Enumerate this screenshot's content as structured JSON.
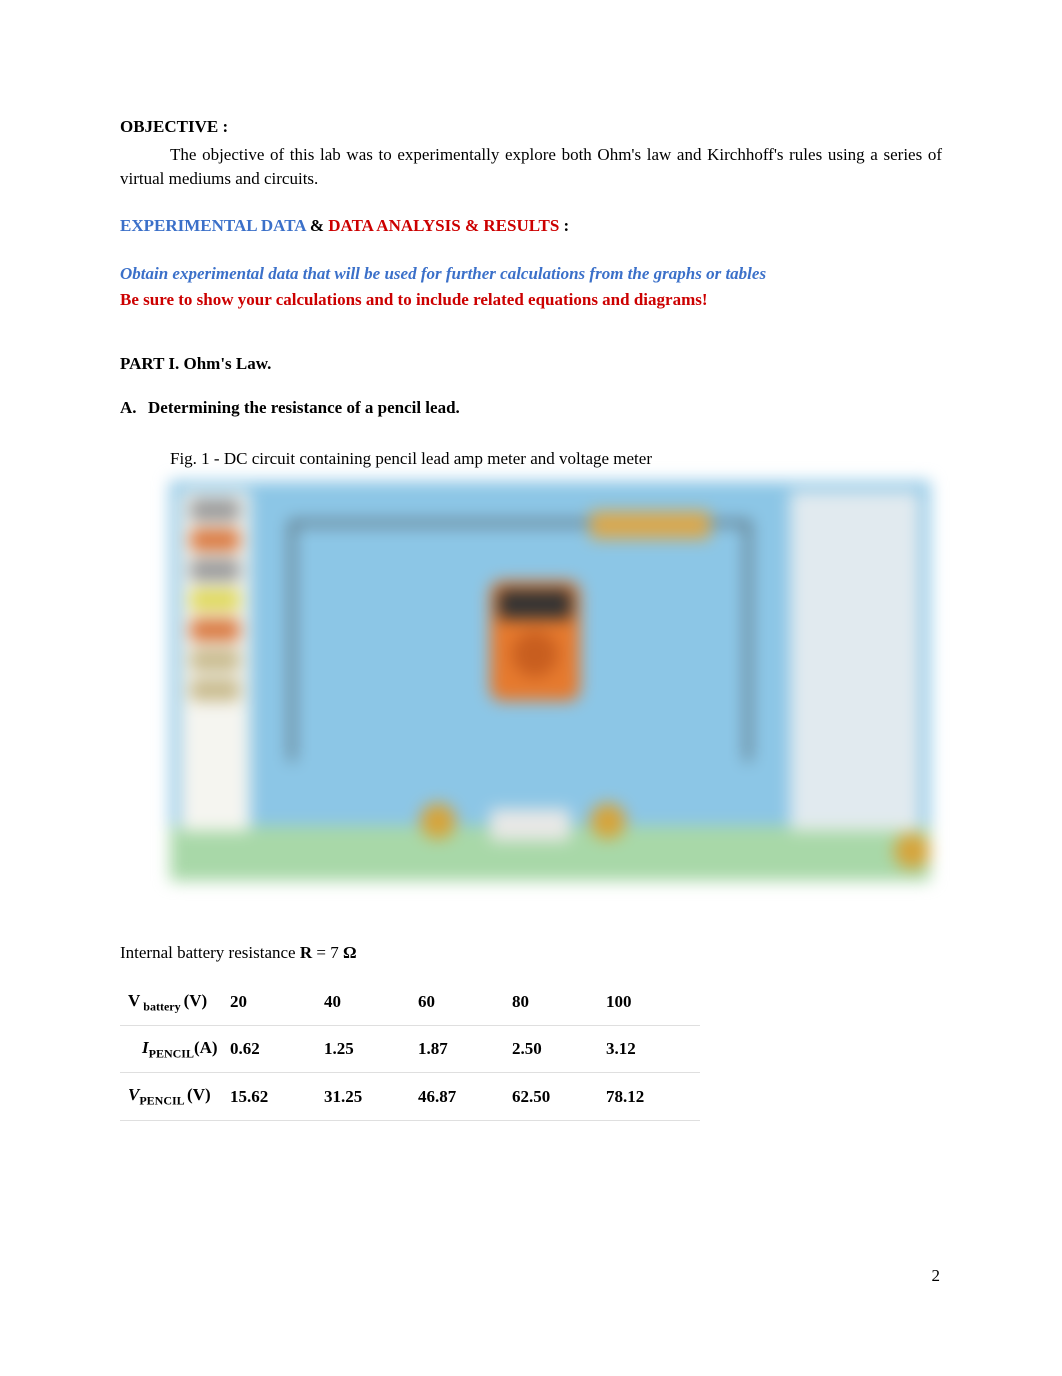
{
  "objective": {
    "title": "OBJECTIVE :",
    "text": "The objective of this lab was to experimentally explore both Ohm's law and Kirchhoff's rules using a series of virtual mediums and circuits."
  },
  "expHeader": {
    "blue": "EXPERIMENTAL DATA",
    "amp": "  &  ",
    "red": "DATA ANALYSIS & RESULTS",
    "colon": " :"
  },
  "instructions": {
    "italic": "Obtain experimental data that will be used for further calculations from the graphs or tables",
    "bold": "Be sure to show your calculations and to include related equations and diagrams!"
  },
  "part1": {
    "title": "PART I. Ohm's Law.",
    "subsection": {
      "letter": "A.",
      "text": "Determining the resistance of a pencil lead."
    },
    "figCaption": "Fig. 1 - DC circuit containing pencil lead amp meter and voltage meter"
  },
  "resistance": {
    "prefix": "Internal battery resistance ",
    "symbol": "R",
    "equals": " = 7 ",
    "unit": "Ω"
  },
  "table": {
    "row1": {
      "label_prefix": "V",
      "label_sub": " battery ",
      "label_suffix": "(V)",
      "col1": "20",
      "col2": "40",
      "col3": "60",
      "col4": "80",
      "col5": "100"
    },
    "row2": {
      "label_prefix": "I",
      "label_sub": "PENCIL",
      "label_suffix": "(A)",
      "col1": "0.62",
      "col2": "1.25",
      "col3": "1.87",
      "col4": "2.50",
      "col5": "3.12"
    },
    "row3": {
      "label_prefix": "V",
      "label_sub": "PENCIL ",
      "label_suffix": "(V)",
      "col1": "15.62",
      "col2": "31.25",
      "col3": "46.87",
      "col4": "62.50",
      "col5": "78.12"
    }
  },
  "pageNumber": "2"
}
